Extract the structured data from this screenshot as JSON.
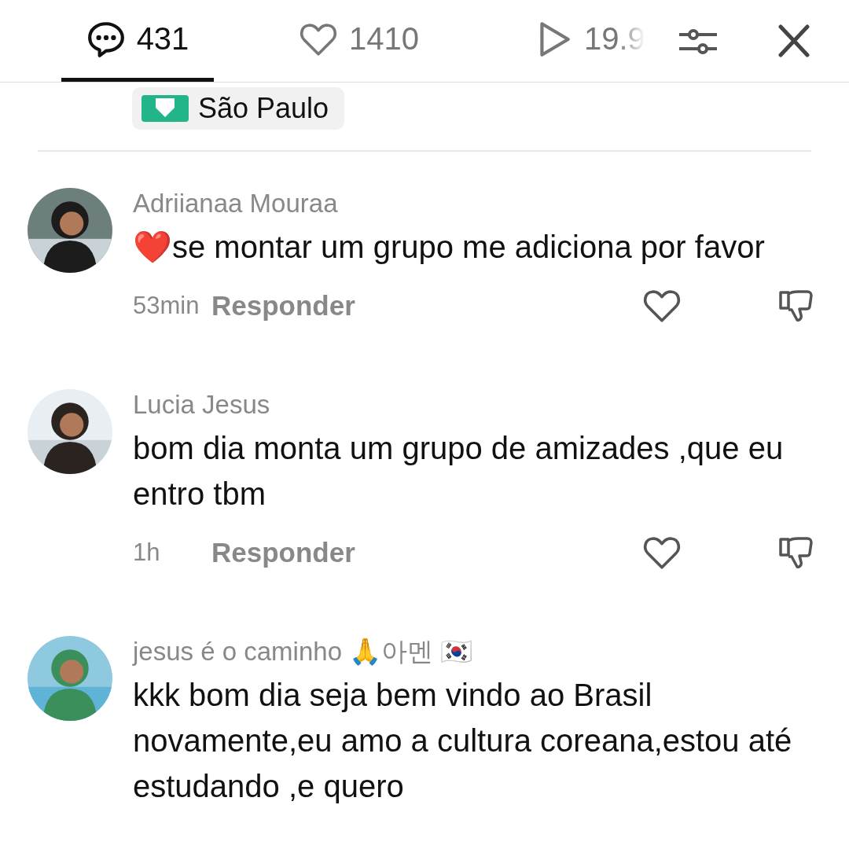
{
  "tabs": [
    {
      "kind": "comments",
      "count": "431",
      "selected": true
    },
    {
      "kind": "likes",
      "count": "1410",
      "selected": false
    },
    {
      "kind": "plays",
      "count": "19.9",
      "selected": false
    }
  ],
  "location": {
    "label": "São Paulo"
  },
  "comments": [
    {
      "name": "Adriianaa Mouraa",
      "text": "❤️se montar um grupo me adiciona por favor",
      "time": "53min",
      "reply": "Responder"
    },
    {
      "name": "Lucia Jesus",
      "text": "bom dia monta um grupo de amizades ,que eu entro tbm",
      "time": "1h",
      "reply": "Responder"
    },
    {
      "name": "jesus é o caminho 🙏아멘 🇰🇷",
      "text": "kkk bom dia seja bem vindo ao Brasil novamente,eu amo a cultura coreana,estou até estudando ,e quero"
    }
  ]
}
